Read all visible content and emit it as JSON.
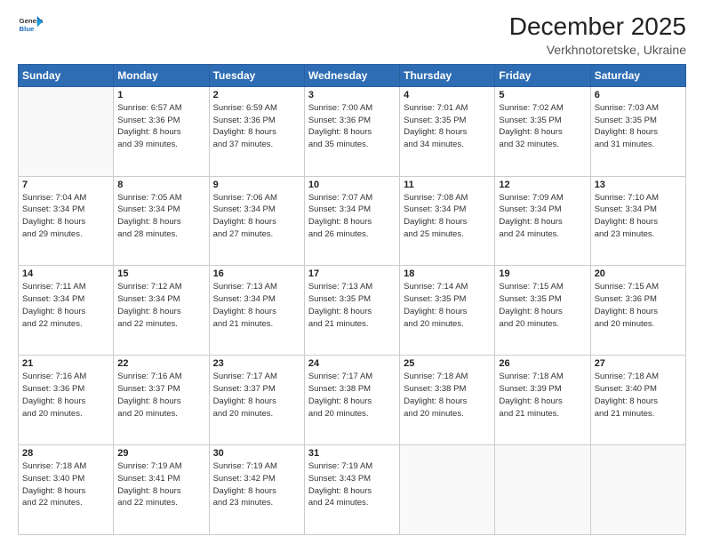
{
  "logo": {
    "line1": "General",
    "line2": "Blue"
  },
  "header": {
    "title": "December 2025",
    "subtitle": "Verkhnotoretske, Ukraine"
  },
  "days_of_week": [
    "Sunday",
    "Monday",
    "Tuesday",
    "Wednesday",
    "Thursday",
    "Friday",
    "Saturday"
  ],
  "weeks": [
    [
      {
        "day": "",
        "empty": true
      },
      {
        "day": "1",
        "sunrise": "6:57 AM",
        "sunset": "3:36 PM",
        "daylight": "8 hours and 39 minutes."
      },
      {
        "day": "2",
        "sunrise": "6:59 AM",
        "sunset": "3:36 PM",
        "daylight": "8 hours and 37 minutes."
      },
      {
        "day": "3",
        "sunrise": "7:00 AM",
        "sunset": "3:36 PM",
        "daylight": "8 hours and 35 minutes."
      },
      {
        "day": "4",
        "sunrise": "7:01 AM",
        "sunset": "3:35 PM",
        "daylight": "8 hours and 34 minutes."
      },
      {
        "day": "5",
        "sunrise": "7:02 AM",
        "sunset": "3:35 PM",
        "daylight": "8 hours and 32 minutes."
      },
      {
        "day": "6",
        "sunrise": "7:03 AM",
        "sunset": "3:35 PM",
        "daylight": "8 hours and 31 minutes."
      }
    ],
    [
      {
        "day": "7",
        "sunrise": "7:04 AM",
        "sunset": "3:34 PM",
        "daylight": "8 hours and 29 minutes."
      },
      {
        "day": "8",
        "sunrise": "7:05 AM",
        "sunset": "3:34 PM",
        "daylight": "8 hours and 28 minutes."
      },
      {
        "day": "9",
        "sunrise": "7:06 AM",
        "sunset": "3:34 PM",
        "daylight": "8 hours and 27 minutes."
      },
      {
        "day": "10",
        "sunrise": "7:07 AM",
        "sunset": "3:34 PM",
        "daylight": "8 hours and 26 minutes."
      },
      {
        "day": "11",
        "sunrise": "7:08 AM",
        "sunset": "3:34 PM",
        "daylight": "8 hours and 25 minutes."
      },
      {
        "day": "12",
        "sunrise": "7:09 AM",
        "sunset": "3:34 PM",
        "daylight": "8 hours and 24 minutes."
      },
      {
        "day": "13",
        "sunrise": "7:10 AM",
        "sunset": "3:34 PM",
        "daylight": "8 hours and 23 minutes."
      }
    ],
    [
      {
        "day": "14",
        "sunrise": "7:11 AM",
        "sunset": "3:34 PM",
        "daylight": "8 hours and 22 minutes."
      },
      {
        "day": "15",
        "sunrise": "7:12 AM",
        "sunset": "3:34 PM",
        "daylight": "8 hours and 22 minutes."
      },
      {
        "day": "16",
        "sunrise": "7:13 AM",
        "sunset": "3:34 PM",
        "daylight": "8 hours and 21 minutes."
      },
      {
        "day": "17",
        "sunrise": "7:13 AM",
        "sunset": "3:35 PM",
        "daylight": "8 hours and 21 minutes."
      },
      {
        "day": "18",
        "sunrise": "7:14 AM",
        "sunset": "3:35 PM",
        "daylight": "8 hours and 20 minutes."
      },
      {
        "day": "19",
        "sunrise": "7:15 AM",
        "sunset": "3:35 PM",
        "daylight": "8 hours and 20 minutes."
      },
      {
        "day": "20",
        "sunrise": "7:15 AM",
        "sunset": "3:36 PM",
        "daylight": "8 hours and 20 minutes."
      }
    ],
    [
      {
        "day": "21",
        "sunrise": "7:16 AM",
        "sunset": "3:36 PM",
        "daylight": "8 hours and 20 minutes."
      },
      {
        "day": "22",
        "sunrise": "7:16 AM",
        "sunset": "3:37 PM",
        "daylight": "8 hours and 20 minutes."
      },
      {
        "day": "23",
        "sunrise": "7:17 AM",
        "sunset": "3:37 PM",
        "daylight": "8 hours and 20 minutes."
      },
      {
        "day": "24",
        "sunrise": "7:17 AM",
        "sunset": "3:38 PM",
        "daylight": "8 hours and 20 minutes."
      },
      {
        "day": "25",
        "sunrise": "7:18 AM",
        "sunset": "3:38 PM",
        "daylight": "8 hours and 20 minutes."
      },
      {
        "day": "26",
        "sunrise": "7:18 AM",
        "sunset": "3:39 PM",
        "daylight": "8 hours and 21 minutes."
      },
      {
        "day": "27",
        "sunrise": "7:18 AM",
        "sunset": "3:40 PM",
        "daylight": "8 hours and 21 minutes."
      }
    ],
    [
      {
        "day": "28",
        "sunrise": "7:18 AM",
        "sunset": "3:40 PM",
        "daylight": "8 hours and 22 minutes."
      },
      {
        "day": "29",
        "sunrise": "7:19 AM",
        "sunset": "3:41 PM",
        "daylight": "8 hours and 22 minutes."
      },
      {
        "day": "30",
        "sunrise": "7:19 AM",
        "sunset": "3:42 PM",
        "daylight": "8 hours and 23 minutes."
      },
      {
        "day": "31",
        "sunrise": "7:19 AM",
        "sunset": "3:43 PM",
        "daylight": "8 hours and 24 minutes."
      },
      {
        "day": "",
        "empty": true
      },
      {
        "day": "",
        "empty": true
      },
      {
        "day": "",
        "empty": true
      }
    ]
  ],
  "labels": {
    "sunrise": "Sunrise:",
    "sunset": "Sunset:",
    "daylight": "Daylight:"
  }
}
